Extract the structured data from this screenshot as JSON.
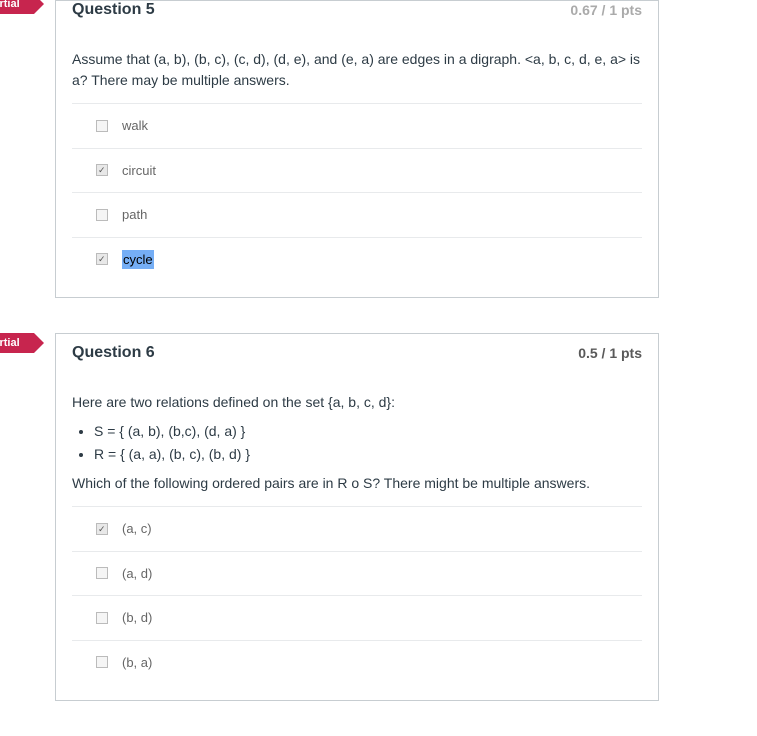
{
  "q5": {
    "ribbon": "Partial",
    "title": "Question 5",
    "points": "0.67 / 1 pts",
    "prompt": "Assume that (a, b), (b, c), (c, d), (d, e), and (e, a) are edges in a digraph. <a, b, c, d, e, a> is a? There may be multiple answers.",
    "answers": [
      {
        "label": "walk",
        "checked": false
      },
      {
        "label": "circuit",
        "checked": true
      },
      {
        "label": "path",
        "checked": false
      },
      {
        "label": "cycle",
        "checked": true,
        "highlight": true
      }
    ]
  },
  "q6": {
    "ribbon": "Partial",
    "title": "Question 6",
    "points": "0.5 / 1 pts",
    "prompt1": "Here are two relations defined on the set {a, b, c, d}:",
    "li1": "S = { (a, b), (b,c), (d, a) }",
    "li2": "R = { (a, a), (b, c), (b, d) }",
    "prompt2": "Which of the following ordered pairs are in R o S? There might be multiple answers.",
    "answers": [
      {
        "label": "(a, c)",
        "checked": true
      },
      {
        "label": "(a, d)",
        "checked": false
      },
      {
        "label": "(b, d)",
        "checked": false
      },
      {
        "label": "(b, a)",
        "checked": false
      }
    ]
  }
}
